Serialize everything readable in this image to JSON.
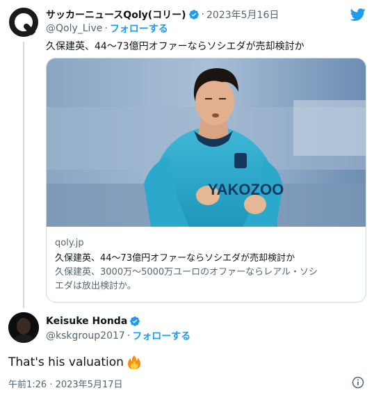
{
  "quoted_tweet": {
    "author_name": "サッカーニュースQoly(コリー)",
    "separator": "·",
    "date": "2023年5月16日",
    "handle": "@Qoly_Live",
    "handle_sep": "·",
    "follow_label": "フォローする",
    "text": "久保建英、44〜73億円オファーならソシエダが売却検討か",
    "card": {
      "domain": "qoly.jp",
      "title": "久保建英、44〜73億円オファーならソシエダが売却検討か",
      "description_line1": "久保建英、3000万〜5000万ユーロのオファーならレアル・ソシ",
      "description_line2": "エダは放出検討か。",
      "image_jersey_text": "YAKOZOO"
    }
  },
  "reply_tweet": {
    "author_name": "Keisuke Honda",
    "handle": "@kskgroup2017",
    "handle_sep": "·",
    "follow_label": "フォローする",
    "text": "That's his valuation",
    "emoji": "fire-emoji",
    "timestamp": "午前1:26 · 2023年5月17日"
  },
  "colors": {
    "accent": "#1d9bf0",
    "text": "#0f1419",
    "muted": "#536471",
    "border": "#cfd9de"
  },
  "icons": [
    "twitter-logo-icon",
    "verified-badge-icon",
    "info-icon",
    "fire-emoji"
  ]
}
